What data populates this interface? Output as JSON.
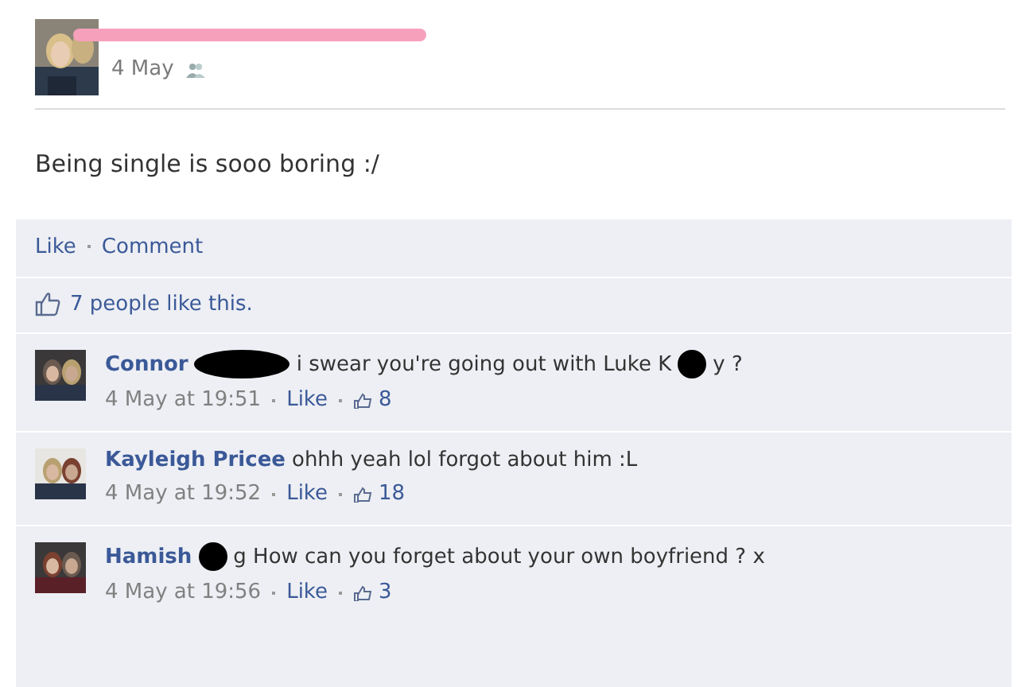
{
  "post": {
    "author_redacted": true,
    "date": "4 May",
    "message": "Being single is sooo boring :/"
  },
  "actions": [
    {
      "label": "Like"
    },
    {
      "label": "Comment"
    }
  ],
  "likes": {
    "text": "7 people like this."
  },
  "comments": [
    {
      "author": "Connor",
      "parts": [
        {
          "kind": "redaction"
        },
        {
          "kind": "text",
          "text": "i swear you're going out with Luke K"
        },
        {
          "kind": "redaction"
        },
        {
          "kind": "text",
          "text": "y ?"
        }
      ],
      "time": "4 May at 19:51",
      "like": "Like",
      "count": "8"
    },
    {
      "author": "Kayleigh Pricee",
      "parts": [
        {
          "kind": "text",
          "text": "ohhh yeah lol forgot about him :L"
        }
      ],
      "time": "4 May at 19:52",
      "like": "Like",
      "count": "18"
    },
    {
      "author": "Hamish",
      "parts": [
        {
          "kind": "redaction"
        },
        {
          "kind": "text",
          "text": "g How can you forget about your own boyfriend ? x"
        }
      ],
      "time": "4 May at 19:56",
      "like": "Like",
      "count": "3"
    }
  ]
}
